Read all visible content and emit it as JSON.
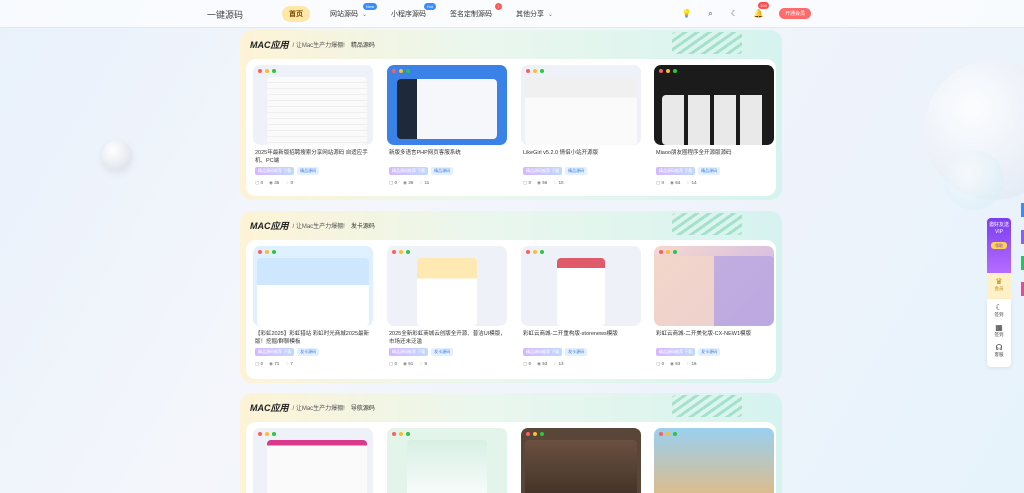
{
  "header": {
    "logo": "一键源码",
    "nav": [
      {
        "label": "首页",
        "active": true
      },
      {
        "label": "网站源码",
        "badge": "New",
        "dropdown": true
      },
      {
        "label": "小程序源码",
        "badge": "Hot",
        "dropdown": false
      },
      {
        "label": "签名定制源码",
        "badge": "!",
        "dropdown": false
      },
      {
        "label": "其他分享",
        "badge": "",
        "dropdown": true
      }
    ],
    "bell_count": "103",
    "vip_button": "开通会员"
  },
  "sections": [
    {
      "title": "MAC应用",
      "subtitle": "/ 让Mac生产力爆棚!",
      "tag": "精品源码",
      "cards": [
        {
          "title": "2025年最新版招聘搜索分享网站源码 自适应手机、PC端",
          "vip": "精品源码推荐 下载",
          "cat": "精品源码",
          "comments": "0",
          "views": "46",
          "likes": "0"
        },
        {
          "title": "新版多语言PHP网页客服系统",
          "vip": "精品源码推荐 下载",
          "cat": "精品源码",
          "comments": "0",
          "views": "39",
          "likes": "11"
        },
        {
          "title": "LikeGirl v5.2.0 情侣小站开源版",
          "vip": "精品源码推荐 下载",
          "cat": "精品源码",
          "comments": "0",
          "views": "56",
          "likes": "10"
        },
        {
          "title": "Miaoo朋友圈程序全开源版源码",
          "vip": "精品源码推荐 下载",
          "cat": "精品源码",
          "comments": "0",
          "views": "64",
          "likes": "14"
        }
      ]
    },
    {
      "title": "MAC应用",
      "subtitle": "/ 让Mac生产力爆棚!",
      "tag": "发卡源码",
      "cards": [
        {
          "title": "【彩虹2025】彩虹猎站 彩虹时光商城2025最新版！挖掘/群聊模板",
          "vip": "精品源码推荐 下载",
          "cat": "发卡源码",
          "comments": "0",
          "views": "71",
          "likes": "7"
        },
        {
          "title": "2025全新彩虹商城云创版全开源、普洁UI模版，市场还未泛滥",
          "vip": "精品源码推荐 下载",
          "cat": "发卡源码",
          "comments": "0",
          "views": "51",
          "likes": "9"
        },
        {
          "title": "彩虹云商城-二开重构版-storenews模版",
          "vip": "精品源码推荐 下载",
          "cat": "发卡源码",
          "comments": "0",
          "views": "53",
          "likes": "13"
        },
        {
          "title": "彩虹云商城-二开美化版-CX-NEW1模版",
          "vip": "精品源码推荐 下载",
          "cat": "发卡源码",
          "comments": "0",
          "views": "53",
          "likes": "16"
        }
      ]
    },
    {
      "title": "MAC应用",
      "subtitle": "/ 让Mac生产力爆棚!",
      "tag": "导航源码",
      "cards": [
        {
          "title": "",
          "vip": "",
          "cat": "",
          "comments": "",
          "views": "",
          "likes": ""
        },
        {
          "title": "",
          "vip": "",
          "cat": "",
          "comments": "",
          "views": "",
          "likes": ""
        },
        {
          "title": "",
          "vip": "",
          "cat": "",
          "comments": "",
          "views": "",
          "likes": ""
        },
        {
          "title": "",
          "vip": "",
          "cat": "",
          "comments": "",
          "views": "",
          "likes": ""
        }
      ]
    }
  ],
  "sidebar": {
    "promo": "邀好友送VIP",
    "promo_btn": "领取",
    "vip": "会员",
    "items": [
      {
        "label": "签到",
        "icon": "moon-icon"
      },
      {
        "label": "签到",
        "icon": "calendar-icon"
      },
      {
        "label": "客服",
        "icon": "headset-icon"
      }
    ]
  },
  "colors": {
    "accent": "#3a8bff",
    "vip": "#ff6b6b",
    "section_grad_start": "#fdf3d6",
    "section_grad_end": "#d6f3ef"
  }
}
